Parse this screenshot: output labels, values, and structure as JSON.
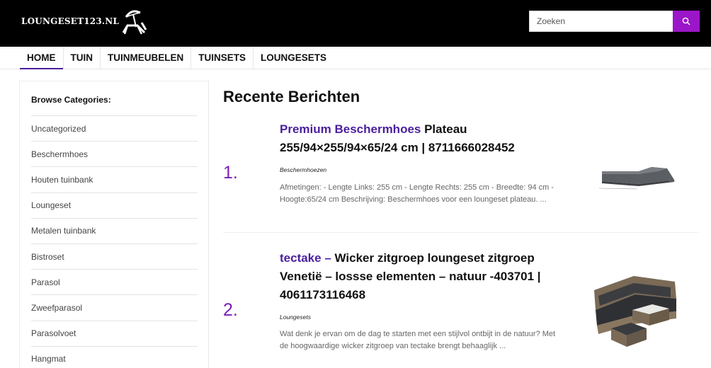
{
  "header": {
    "logo_text": "LOUNGESET123.NL",
    "search_placeholder": "Zoeken",
    "colors": {
      "background": "#000000",
      "search_button": "#9b16c8"
    }
  },
  "nav": {
    "items": [
      {
        "label": "HOME",
        "active": true
      },
      {
        "label": "TUIN"
      },
      {
        "label": "TUINMEUBELEN"
      },
      {
        "label": "TUINSETS"
      },
      {
        "label": "LOUNGESETS"
      }
    ],
    "active_color": "#4a1f9e"
  },
  "sidebar": {
    "heading": "Browse Categories:",
    "categories": [
      "Uncategorized",
      "Beschermhoes",
      "Houten tuinbank",
      "Loungeset",
      "Metalen tuinbank",
      "Bistroset",
      "Parasol",
      "Zweefparasol",
      "Parasolvoet",
      "Hangmat"
    ]
  },
  "main": {
    "title": "Recente Berichten",
    "posts": [
      {
        "number": "1.",
        "title_highlight": "Premium Beschermhoes",
        "title_rest": " Plateau 255/94×255/94×65/24 cm | 8711666028452",
        "category": "Beschermhoezen",
        "excerpt": "Afmetingen: - Lengte Links: 255 cm - Lengte Rechts: 255 cm - Breedte: 94 cm - Hoogte:65/24 cm Beschrijving: Beschermhoes voor een loungeset plateau. ...",
        "thumb_icon": "corner-cover-icon"
      },
      {
        "number": "2.",
        "title_highlight": "tectake –",
        "title_rest": " Wicker zitgroep loungeset zitgroep Venetië – lossse elementen – natuur -403701 | 4061173116468",
        "category": "Loungesets",
        "excerpt": "Wat denk je ervan om de dag te starten met een stijlvol ontbijt in de natuur? Met de hoogwaardige wicker zitgroep van tectake brengt behaaglijk ...",
        "thumb_icon": "wicker-lounge-set-icon"
      }
    ],
    "accent_color": "#7a1fb8"
  }
}
